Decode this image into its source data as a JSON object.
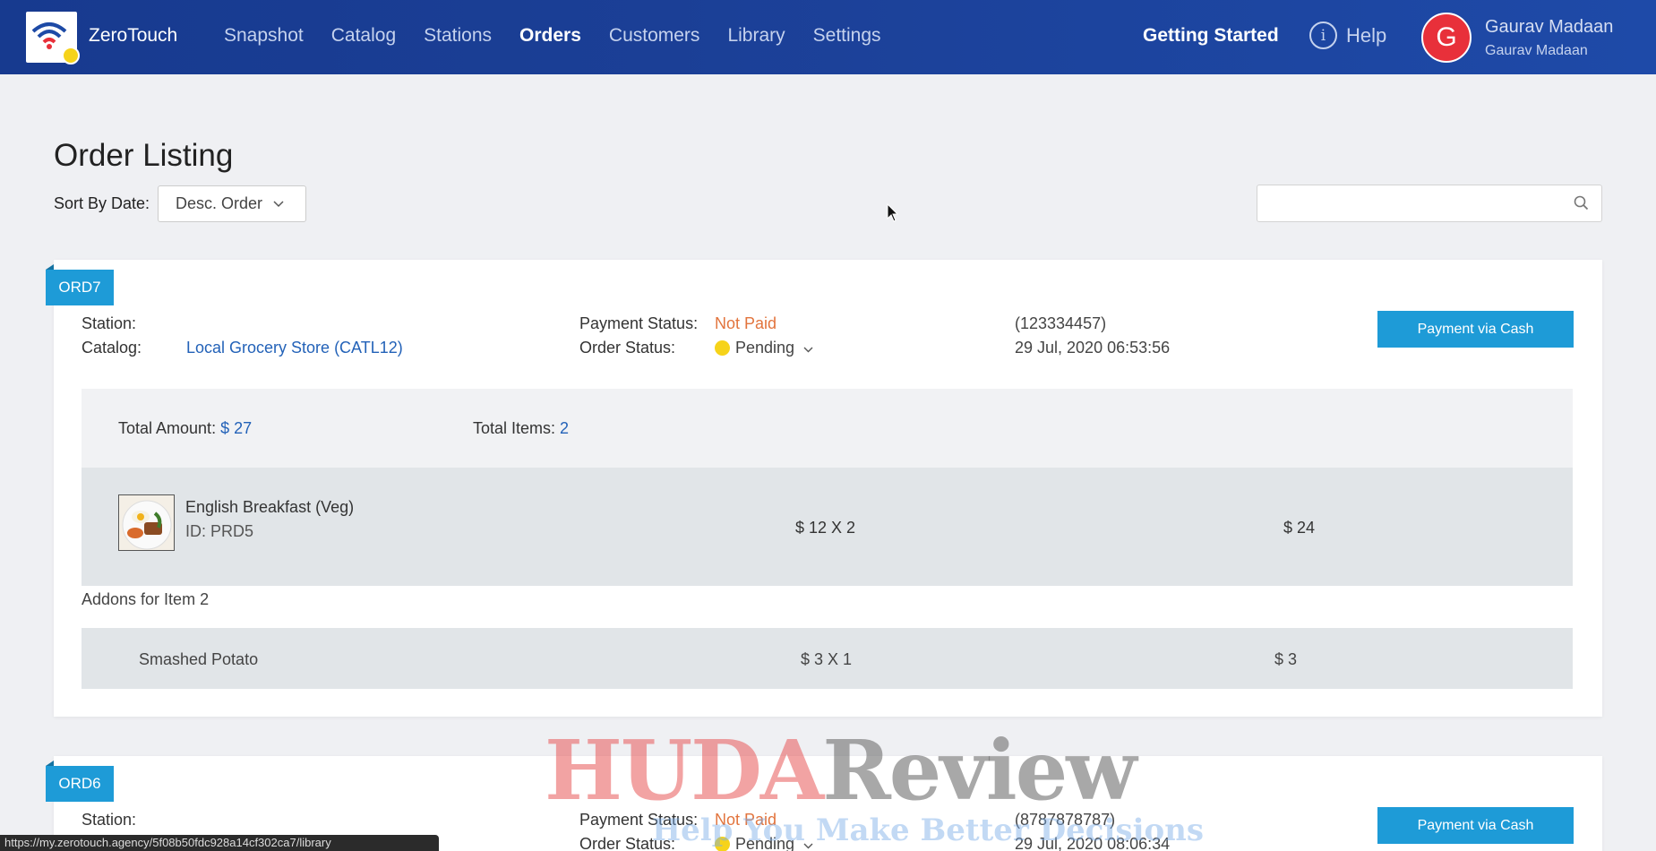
{
  "brand": {
    "name_light": "Zero",
    "name_bold": "Touch"
  },
  "nav": {
    "items": [
      {
        "label": "Snapshot"
      },
      {
        "label": "Catalog"
      },
      {
        "label": "Stations"
      },
      {
        "label": "Orders"
      },
      {
        "label": "Customers"
      },
      {
        "label": "Library"
      },
      {
        "label": "Settings"
      }
    ],
    "active": "Orders",
    "getting_started": "Getting Started",
    "help": "Help",
    "help_icon_glyph": "i"
  },
  "user": {
    "initial": "G",
    "name": "Gaurav Madaan",
    "subtitle": "Gaurav Madaan"
  },
  "page": {
    "title": "Order Listing",
    "sort_label": "Sort By Date:",
    "sort_value": "Desc. Order",
    "search_placeholder": ""
  },
  "labels": {
    "station": "Station:",
    "catalog": "Catalog:",
    "payment_status": "Payment Status:",
    "order_status": "Order Status:",
    "total_amount": "Total Amount:",
    "total_items": "Total Items:",
    "pay_button": "Payment via Cash"
  },
  "orders": [
    {
      "id": "ORD7",
      "station": "",
      "catalog": "Local Grocery Store (CATL12)",
      "payment_status": "Not Paid",
      "order_status": "Pending",
      "phone": "(123334457)",
      "datetime": "29 Jul, 2020 06:53:56",
      "total_amount": "$ 27",
      "total_items": "2",
      "items": [
        {
          "name": "English Breakfast (Veg)",
          "id_text": "ID: PRD5",
          "qty_price": "$ 12 X 2",
          "total": "$ 24"
        }
      ],
      "addons_title": "Addons for Item 2",
      "addons": [
        {
          "name": "Smashed Potato",
          "qty_price": "$ 3 X 1",
          "total": "$ 3"
        }
      ]
    },
    {
      "id": "ORD6",
      "station": "",
      "payment_status": "Not Paid",
      "order_status": "Pending",
      "phone": "(8787878787)",
      "datetime": "29 Jul, 2020 08:06:34"
    }
  ],
  "status_url": "https://my.zerotouch.agency/5f08b50fdc928a14cf302ca7/library",
  "watermark": {
    "part1": "HUDA",
    "part2": "Review",
    "tagline": "Help You Make Better Decisions"
  },
  "colors": {
    "nav_bg": "#1b3f96",
    "accent": "#1e9bd7",
    "not_paid": "#e2743d",
    "pending_dot": "#f6d31a",
    "link": "#2362b8",
    "avatar": "#e8303a"
  }
}
